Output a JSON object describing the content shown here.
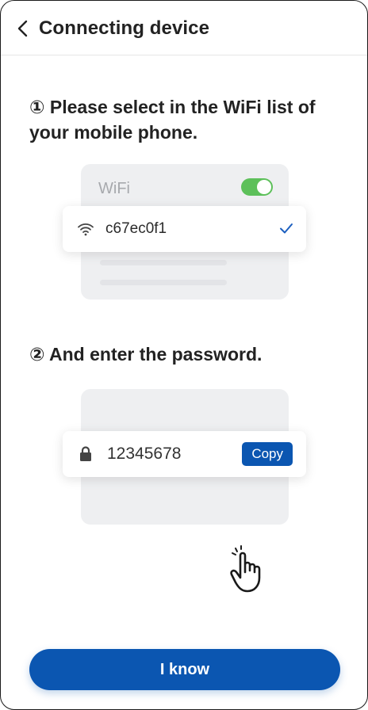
{
  "header": {
    "title": "Connecting device"
  },
  "steps": [
    {
      "text": "① Please select in the WiFi list of your mobile phone."
    },
    {
      "text": "② And enter the password."
    }
  ],
  "wifi_illustration": {
    "label": "WiFi",
    "toggle_on": true,
    "network_name": "c67ec0f1"
  },
  "password_illustration": {
    "password": "12345678",
    "copy_label": "Copy"
  },
  "footer": {
    "primary_label": "I know"
  },
  "colors": {
    "accent": "#0b56b1",
    "toggle_on": "#5dc05a",
    "illustration_bg": "#eeeff1",
    "text": "#222222"
  },
  "icons": {
    "back": "chevron-left-icon",
    "wifi": "wifi-icon",
    "check": "check-icon",
    "lock": "lock-icon",
    "hand": "tap-hand-icon"
  }
}
